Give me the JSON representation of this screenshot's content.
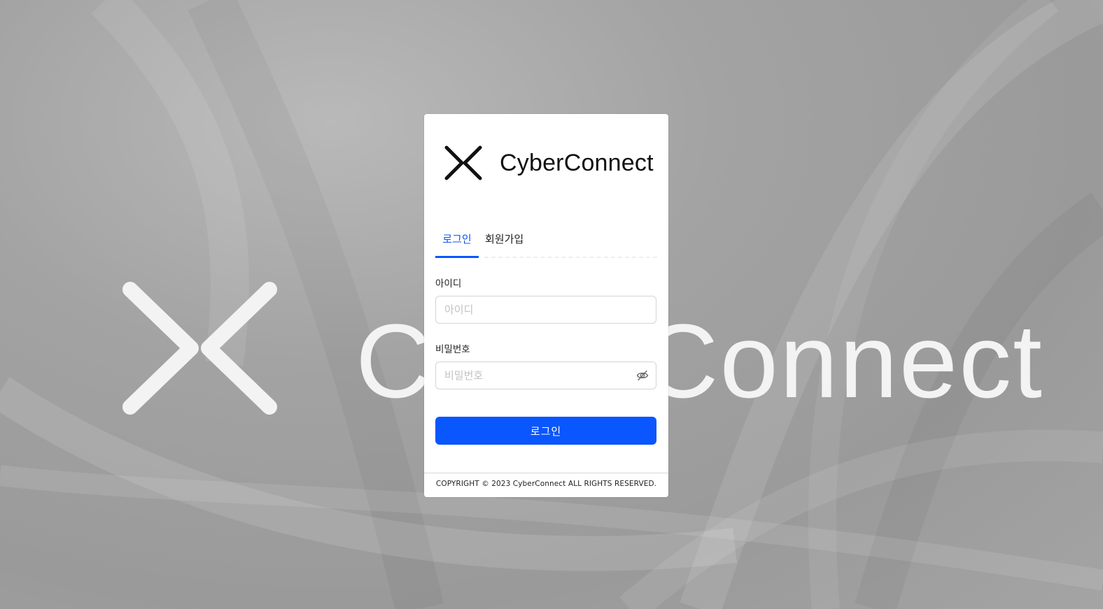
{
  "background": {
    "brand_text": "CyberConnect",
    "color": "#a3a3a3"
  },
  "logo": {
    "icon": "cyberconnect-logo-icon",
    "text": "CyberConnect"
  },
  "tabs": [
    {
      "label": "로그인",
      "active": true
    },
    {
      "label": "회원가입",
      "active": false
    }
  ],
  "form": {
    "id_label": "아이디",
    "id_placeholder": "아이디",
    "id_value": "",
    "password_label": "비밀번호",
    "password_placeholder": "비밀번호",
    "password_value": "",
    "password_toggle_icon": "eye-slash-icon",
    "submit_label": "로그인"
  },
  "footer": {
    "copyright": "COPYRIGHT © 2023 CyberConnect ALL RIGHTS RESERVED."
  },
  "colors": {
    "accent": "#0a56ff",
    "text": "#222222",
    "placeholder": "#c2c2c2"
  }
}
